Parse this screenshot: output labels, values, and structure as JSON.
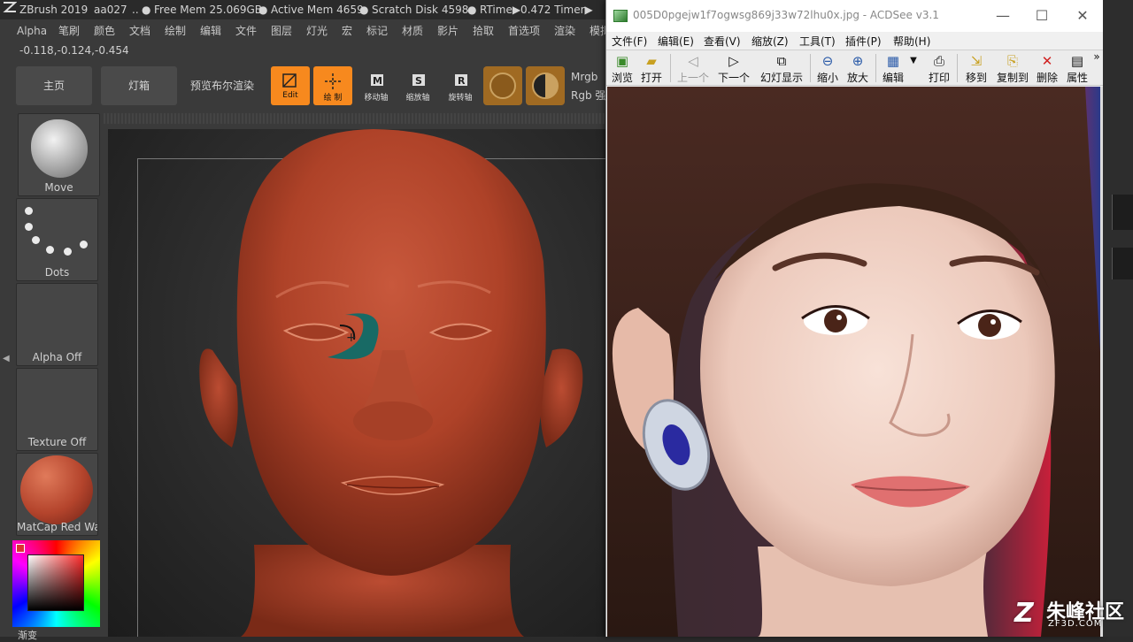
{
  "zbrush": {
    "title": {
      "app": "ZBrush 2019",
      "user": "aa027",
      "free_mem": "Free Mem 25.069GB",
      "active_mem": "Active Mem 4659",
      "scratch_disk": "Scratch Disk 4598",
      "rtime": "RTime▶0.472 Timer▶"
    },
    "menu": [
      "Alpha",
      "笔刷",
      "颜色",
      "文档",
      "绘制",
      "编辑",
      "文件",
      "图层",
      "灯光",
      "宏",
      "标记",
      "材质",
      "影片",
      "拾取",
      "首选项",
      "渲染",
      "模拟"
    ],
    "coords": "-0.118,-0.124,-0.454",
    "shelf": {
      "home": "主页",
      "lightbox": "灯箱",
      "bpr": "预览布尔渲染",
      "edit": "Edit",
      "draw": "绘 制",
      "move": "移动轴",
      "scale": "缩放轴",
      "rotate": "旋转轴",
      "move_letter": "M",
      "scale_letter": "S",
      "rotate_letter": "R",
      "mrgb": "Mrgb",
      "rgb": "Rgb 强"
    },
    "side": {
      "brush": "Move",
      "stroke": "Dots",
      "alpha": "Alpha Off",
      "texture": "Texture Off",
      "material": "MatCap Red Wax",
      "bottom": "渐变"
    },
    "colors": {
      "accent_orange": "#f7891e",
      "model_clay": "#b4442c",
      "mask_teal": "#0f6b68"
    }
  },
  "acdsee": {
    "title": "005D0pgejw1f7ogwsg869j33w72lhu0x.jpg - ACDSee v3.1",
    "window_controls": {
      "minimize": "—",
      "maximize": "☐",
      "close": "✕"
    },
    "menu": [
      "文件(F)",
      "编辑(E)",
      "查看(V)",
      "缩放(Z)",
      "工具(T)",
      "插件(P)",
      "帮助(H)"
    ],
    "toolbar": {
      "browse": "浏览",
      "open": "打开",
      "prev": "上一个",
      "next": "下一个",
      "slideshow": "幻灯显示",
      "zoom_out": "缩小",
      "zoom_in": "放大",
      "edit": "编辑",
      "print": "打印",
      "move_to": "移到",
      "copy_to": "复制到",
      "delete": "删除",
      "properties": "属性",
      "more": "»"
    }
  },
  "watermark": {
    "cn": "朱峰社区",
    "en": "ZF3D.COM",
    "mark": "Z"
  }
}
